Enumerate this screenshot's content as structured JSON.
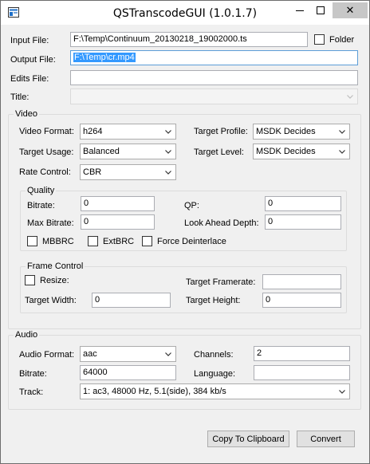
{
  "window": {
    "title": "QSTranscodeGUI (1.0.1.7)",
    "close_symbol": "✕"
  },
  "files": {
    "input_label": "Input File:",
    "input_value": "F:\\Temp\\Continuum_20130218_19002000.ts",
    "folder_label": "Folder",
    "output_label": "Output File:",
    "output_value": "F:\\Temp\\cr.mp4",
    "edits_label": "Edits File:",
    "edits_value": "",
    "title_label": "Title:",
    "title_value": ""
  },
  "video": {
    "group_label": "Video",
    "format_label": "Video Format:",
    "format_value": "h264",
    "profile_label": "Target Profile:",
    "profile_value": "MSDK Decides",
    "usage_label": "Target Usage:",
    "usage_value": "Balanced",
    "level_label": "Target Level:",
    "level_value": "MSDK Decides",
    "rate_label": "Rate Control:",
    "rate_value": "CBR",
    "quality": {
      "group_label": "Quality",
      "bitrate_label": "Bitrate:",
      "bitrate_value": "0",
      "qp_label": "QP:",
      "qp_value": "0",
      "max_bitrate_label": "Max Bitrate:",
      "max_bitrate_value": "0",
      "lookahead_label": "Look Ahead Depth:",
      "lookahead_value": "0",
      "mbbrc_label": "MBBRC",
      "extbrc_label": "ExtBRC",
      "deinterlace_label": "Force Deinterlace"
    },
    "frame": {
      "group_label": "Frame Control",
      "resize_label": "Resize:",
      "framerate_label": "Target Framerate:",
      "framerate_value": "",
      "width_label": "Target Width:",
      "width_value": "0",
      "height_label": "Target Height:",
      "height_value": "0"
    }
  },
  "audio": {
    "group_label": "Audio",
    "format_label": "Audio Format:",
    "format_value": "aac",
    "channels_label": "Channels:",
    "channels_value": "2",
    "bitrate_label": "Bitrate:",
    "bitrate_value": "64000",
    "language_label": "Language:",
    "language_value": "",
    "track_label": "Track:",
    "track_value": "1: ac3, 48000 Hz, 5.1(side), 384 kb/s"
  },
  "actions": {
    "clipboard_label": "Copy To Clipboard",
    "convert_label": "Convert"
  }
}
